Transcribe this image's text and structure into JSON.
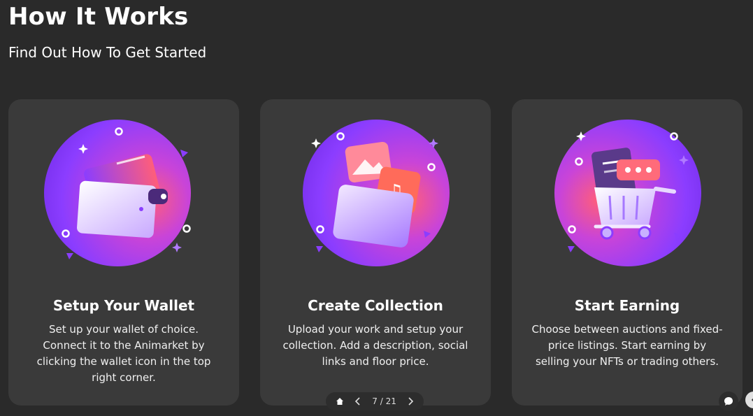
{
  "header": {
    "title": "How It Works",
    "subtitle": "Find Out How To Get Started"
  },
  "cards": [
    {
      "title": "Setup Your Wallet",
      "description": "Set up your wallet of choice. Connect it to the Animarket by clicking the wallet icon in the top right corner.",
      "icon": "wallet-icon"
    },
    {
      "title": "Create Collection",
      "description": "Upload your work and setup your collection. Add a description, social links and floor price.",
      "icon": "folder-icon"
    },
    {
      "title": "Start Earning",
      "description": "Choose between auctions and fixed-price listings. Start earning by selling your NFTs or trading others.",
      "icon": "shopping-cart-icon"
    }
  ],
  "pager": {
    "page_label": "7 / 21",
    "icons": {
      "home": "home-icon",
      "prev": "chevron-left-icon",
      "next": "chevron-right-icon"
    }
  },
  "widgets": {
    "chat_icon": "chat-bubble-icon",
    "edge_icon": "chevron-icon"
  },
  "colors": {
    "background": "#2a2a2a",
    "card": "#3a3a3a",
    "purple": "#8b3dff",
    "pink": "#ff5e7a"
  }
}
